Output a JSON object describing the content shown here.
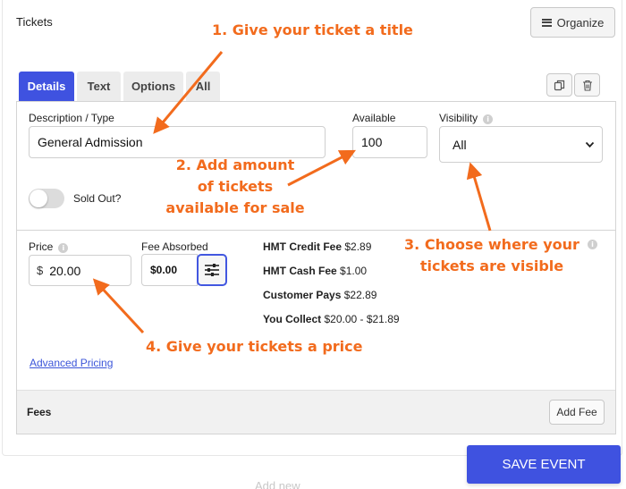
{
  "section": {
    "title": "Tickets",
    "organize_label": "Organize"
  },
  "tabs": [
    {
      "label": "Details",
      "active": true
    },
    {
      "label": "Text",
      "active": false
    },
    {
      "label": "Options",
      "active": false
    },
    {
      "label": "All",
      "active": false
    }
  ],
  "details": {
    "description_label": "Description / Type",
    "description_value": "General Admission",
    "available_label": "Available",
    "available_value": "100",
    "visibility_label": "Visibility",
    "visibility_value": "All",
    "sold_out_label": "Sold Out?"
  },
  "pricing": {
    "price_label": "Price",
    "currency_symbol": "$",
    "price_value": "20.00",
    "fee_absorbed_label": "Fee Absorbed",
    "fee_absorbed_value": "$0.00",
    "credit_fee_label": "HMT Credit Fee",
    "credit_fee_value": "$2.89",
    "cash_fee_label": "HMT Cash Fee",
    "cash_fee_value": "$1.00",
    "customer_pays_label": "Customer Pays",
    "customer_pays_value": "$22.89",
    "you_collect_label": "You Collect",
    "you_collect_value": "$20.00 - $21.89",
    "advanced_pricing_link": "Advanced Pricing"
  },
  "fees": {
    "title": "Fees",
    "add_fee_label": "Add Fee"
  },
  "footer": {
    "save_label": "SAVE EVENT",
    "add_new_label": "Add new"
  },
  "annotations": {
    "step1": "1. Give your ticket a title",
    "step2_line1": "2. Add amount",
    "step2_line2": "of tickets",
    "step2_line3": "available for sale",
    "step3_line1": "3. Choose where your",
    "step3_line2": "tickets are visible",
    "step4": "4. Give your tickets a price"
  },
  "colors": {
    "accent": "#3f52e0",
    "annotation": "#f26b1d",
    "link": "#3b55d9"
  },
  "icons": [
    "hamburger-icon",
    "copy-icon",
    "trash-icon",
    "info-icon",
    "chevron-down-icon",
    "sliders-icon"
  ]
}
